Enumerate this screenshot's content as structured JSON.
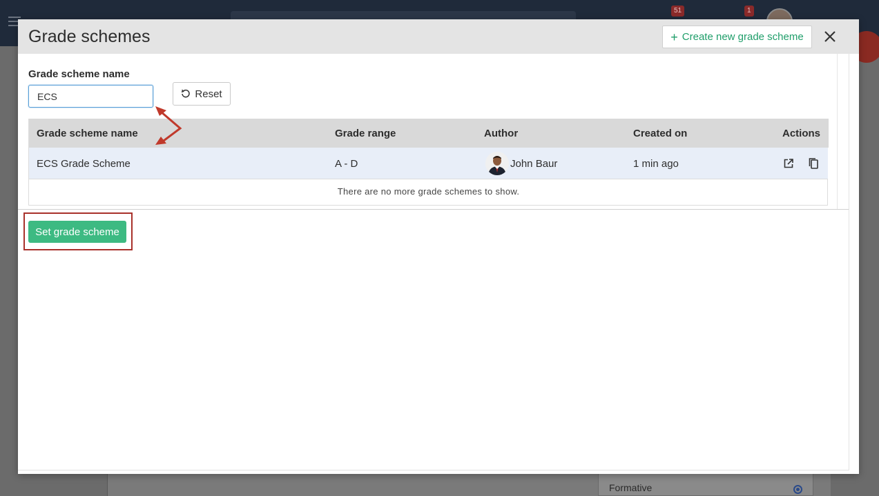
{
  "background": {
    "badges": [
      "51",
      "1"
    ],
    "formative_label": "Formative"
  },
  "modal": {
    "title": "Grade schemes",
    "create_button_label": "Create new grade scheme",
    "close_icon": "close-icon",
    "search": {
      "label": "Grade scheme name",
      "value": "ECS"
    },
    "reset_button_label": "Reset",
    "table": {
      "headers": {
        "name": "Grade scheme name",
        "range": "Grade range",
        "author": "Author",
        "created": "Created on",
        "actions": "Actions"
      },
      "rows": [
        {
          "name": "ECS Grade Scheme",
          "range": "A - D",
          "author": "John Baur",
          "created": "1 min ago",
          "actions": [
            "open-external-icon",
            "copy-icon"
          ]
        }
      ],
      "empty_message": "There are no more grade schemes to show."
    },
    "set_button_label": "Set grade scheme"
  },
  "colors": {
    "accent_green": "#3dba82",
    "create_text_green": "#1f9e6a",
    "annotation_red": "#a8302a",
    "row_highlight": "#e8eef8"
  }
}
